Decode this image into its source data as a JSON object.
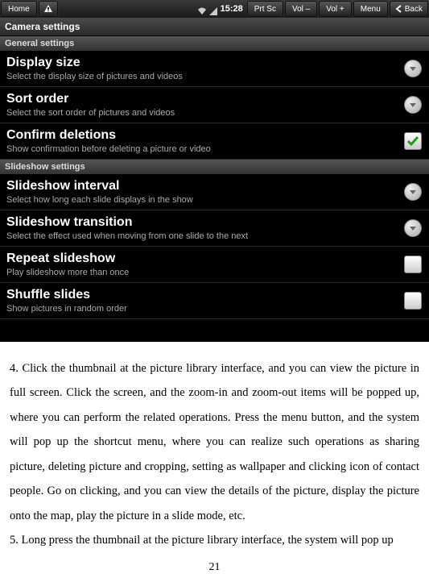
{
  "topbar": {
    "home": "Home",
    "time": "15:28",
    "prtsc": "Prt Sc",
    "volDown": "Vol –",
    "volUp": "Vol +",
    "menu": "Menu",
    "back": "Back"
  },
  "pageTitle": "Camera settings",
  "sections": {
    "general": "General settings",
    "slideshow": "Slideshow settings"
  },
  "rows": {
    "displaySize": {
      "title": "Display size",
      "sub": "Select the display size of pictures and videos"
    },
    "sortOrder": {
      "title": "Sort order",
      "sub": "Select the sort order of pictures and videos"
    },
    "confirmDel": {
      "title": "Confirm deletions",
      "sub": "Show confirmation before deleting a picture or video"
    },
    "interval": {
      "title": "Slideshow interval",
      "sub": "Select how long each slide displays in the show"
    },
    "transition": {
      "title": "Slideshow transition",
      "sub": "Select the effect used when moving from one slide to the next"
    },
    "repeat": {
      "title": "Repeat slideshow",
      "sub": "Play slideshow more than once"
    },
    "shuffle": {
      "title": "Shuffle slides",
      "sub": "Show pictures in random order"
    }
  },
  "doc": {
    "p4": "4. Click the thumbnail at the picture library interface, and you can view the picture in full screen. Click the screen, and the zoom-in and zoom-out items will be popped up, where you can perform the related operations. Press the menu button, and the system will pop up the shortcut menu, where you can realize such operations as sharing picture, deleting picture and cropping, setting as wallpaper and clicking icon of contact people. Go on clicking, and you can view the details of the picture, display the picture onto the map, play the picture in a slide mode, etc.",
    "p5": "5. Long press the thumbnail at the picture library interface, the system will pop up",
    "pageNum": "21"
  }
}
